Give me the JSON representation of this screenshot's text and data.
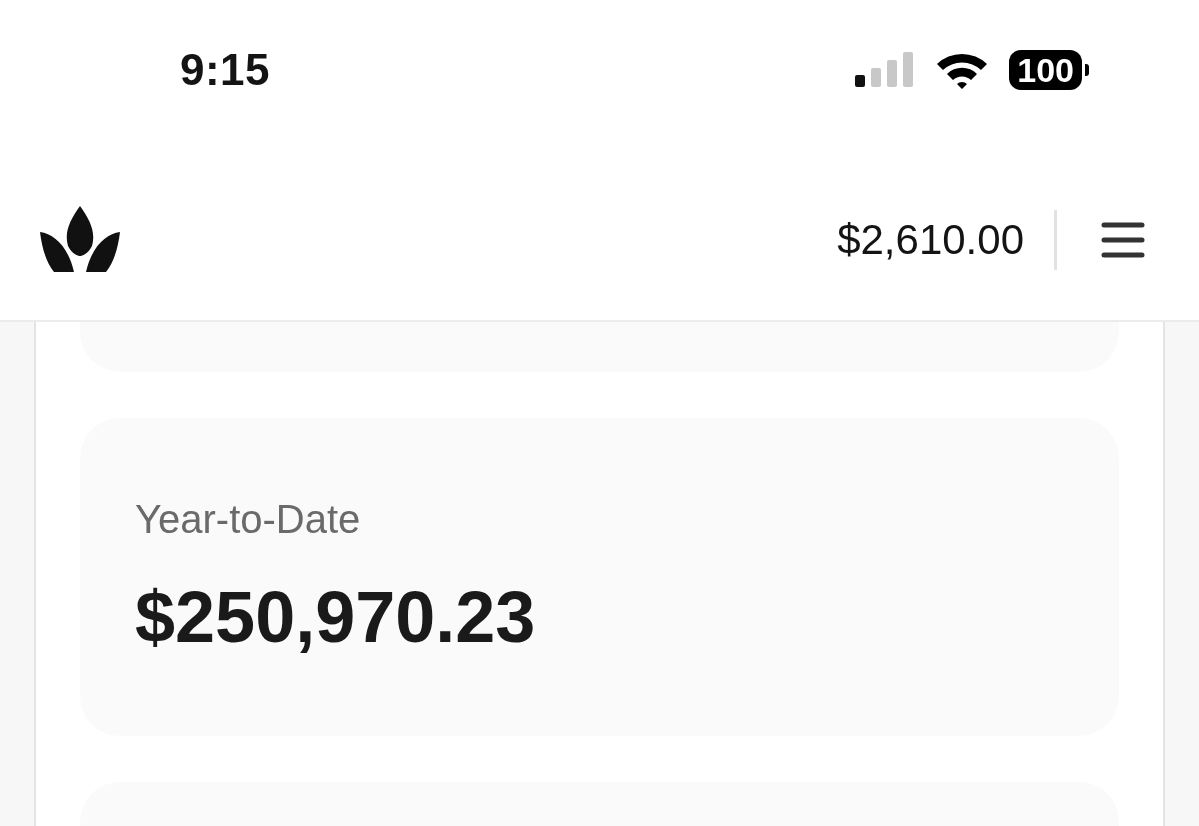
{
  "status_bar": {
    "time": "9:15",
    "battery": "100"
  },
  "header": {
    "balance": "$2,610.00"
  },
  "summary_card": {
    "label": "Year-to-Date",
    "amount": "$250,970.23"
  }
}
